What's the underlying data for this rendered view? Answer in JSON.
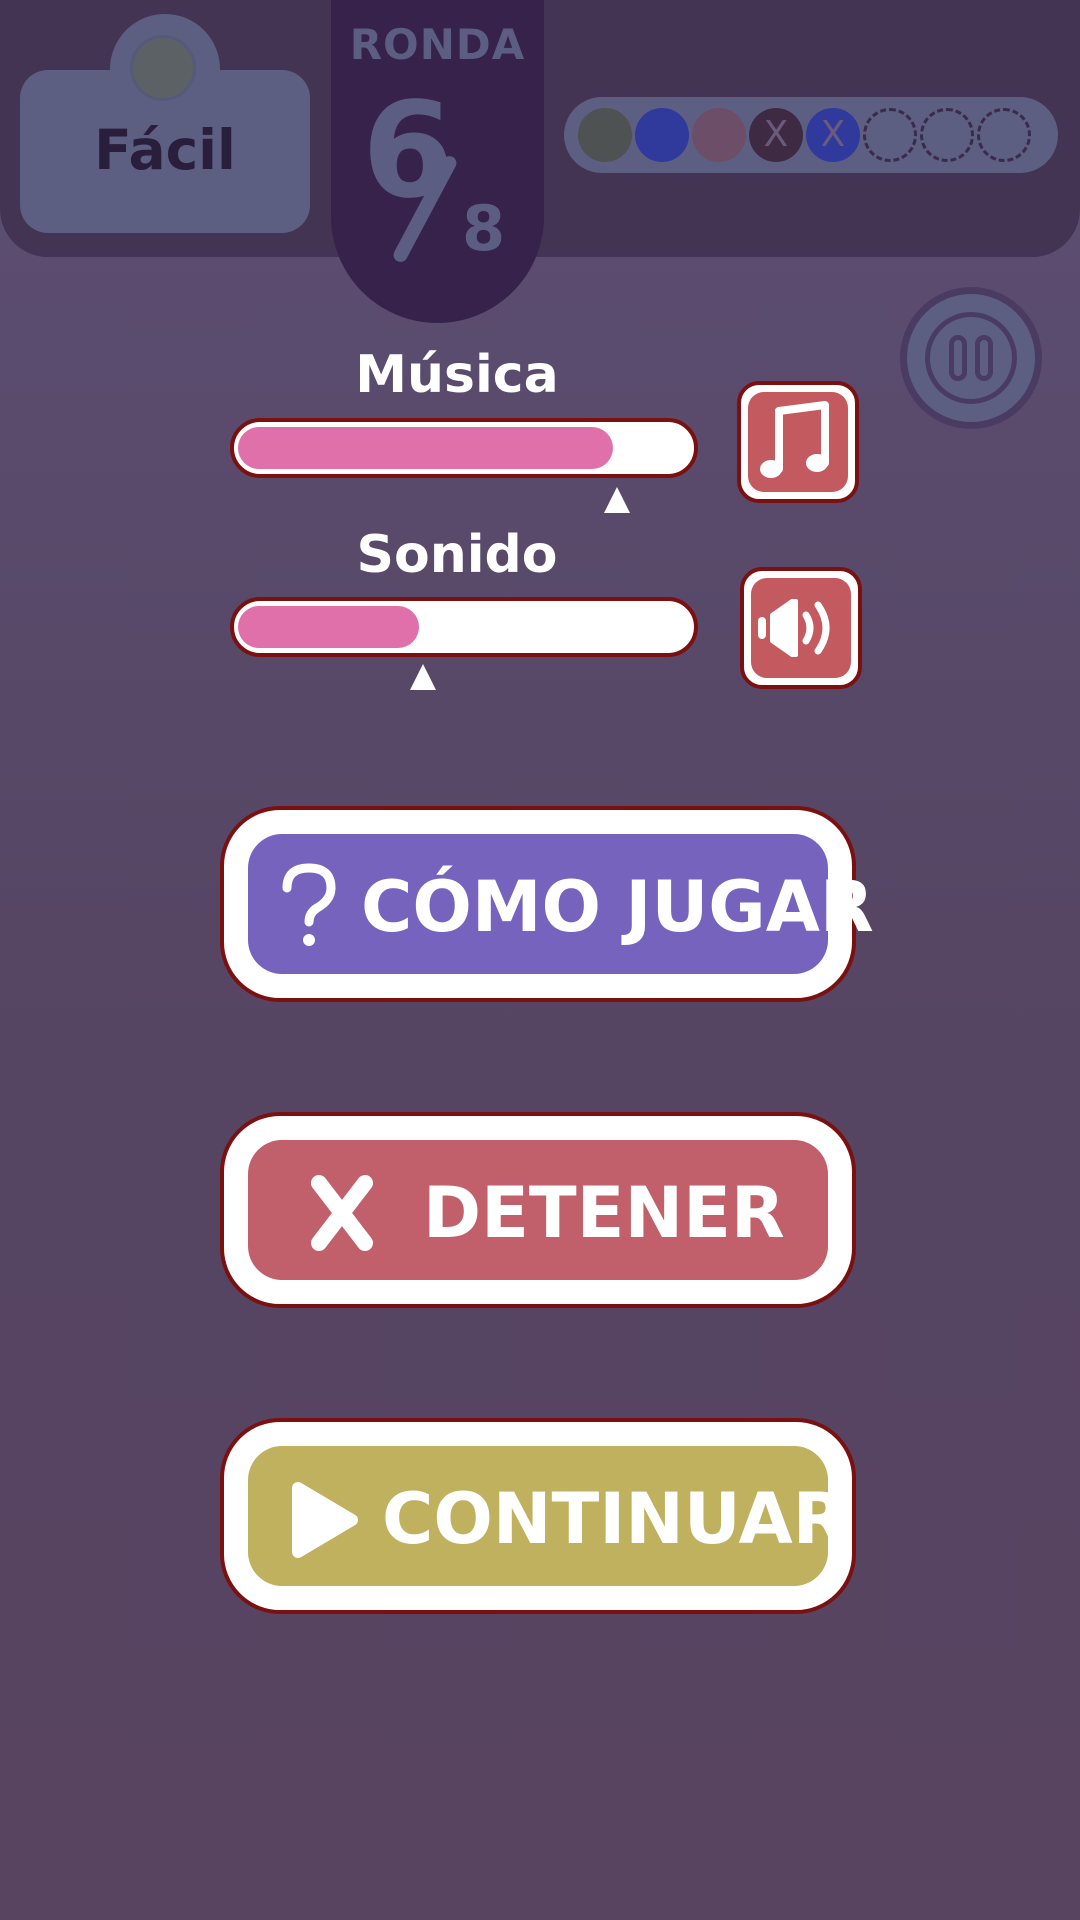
{
  "hud": {
    "difficulty": "Fácil",
    "round_label": "RONDA",
    "round_current": "6",
    "round_total": "8",
    "progress_dots": [
      {
        "state": "filled",
        "color": "#4e5252",
        "mark": ""
      },
      {
        "state": "filled",
        "color": "#2f3a9c",
        "mark": ""
      },
      {
        "state": "filled",
        "color": "#6d4e68",
        "mark": ""
      },
      {
        "state": "filled",
        "color": "#3f2a43",
        "mark": "X"
      },
      {
        "state": "filled",
        "color": "#2f3a9c",
        "mark": "X"
      },
      {
        "state": "empty",
        "color": "",
        "mark": ""
      },
      {
        "state": "empty",
        "color": "",
        "mark": ""
      },
      {
        "state": "empty",
        "color": "",
        "mark": ""
      }
    ]
  },
  "settings": {
    "music": {
      "label": "Música",
      "level": 0.83,
      "icon": "music-note-icon"
    },
    "sound": {
      "label": "Sonido",
      "level": 0.4,
      "icon": "speaker-icon"
    }
  },
  "menu": {
    "how_to_play": {
      "label": "CÓMO JUGAR",
      "color": "#7663bd",
      "icon": "question-icon"
    },
    "stop": {
      "label": "DETENER",
      "color": "#c15f6b",
      "icon": "close-icon"
    },
    "continue": {
      "label": "CONTINUAR",
      "color": "#bfb15e",
      "icon": "play-icon"
    }
  },
  "colors": {
    "background": "#584a6b",
    "panel": "#433453",
    "button_border": "#7a1010",
    "slider_fill": "#df70a9"
  }
}
